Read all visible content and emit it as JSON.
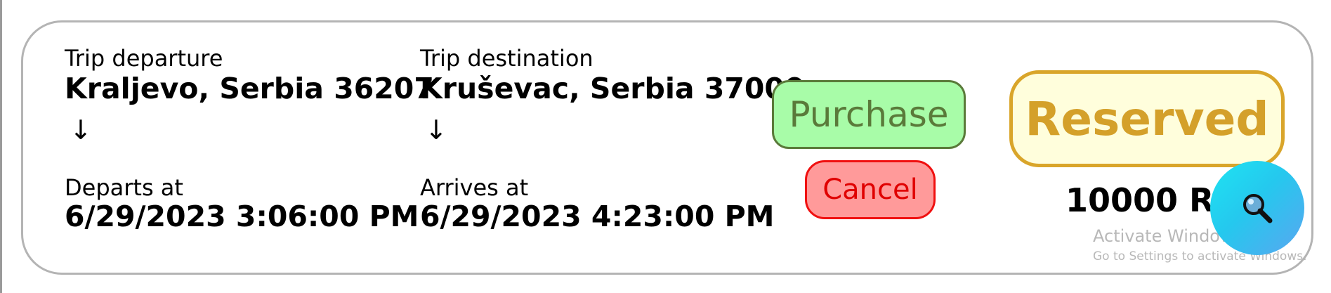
{
  "trip": {
    "departure_label": "Trip departure",
    "departure_value": "Kraljevo, Serbia 36207",
    "departure_arrow": "↓",
    "departs_label": "Departs at",
    "departs_value": "6/29/2023 3:06:00 PM",
    "destination_label": "Trip destination",
    "destination_value": "Kruševac, Serbia 37000",
    "destination_arrow": "↓",
    "arrives_label": "Arrives at",
    "arrives_value": "6/29/2023 4:23:00 PM"
  },
  "actions": {
    "purchase_label": "Purchase",
    "cancel_label": "Cancel"
  },
  "status": {
    "label": "Reserved",
    "price": "10000 RSD"
  },
  "overlay": {
    "watermark_title": "Activate Windows",
    "watermark_subtitle": "Go to Settings to activate Windows.",
    "fab_icon": "search-icon"
  },
  "colors": {
    "purchase_bg": "#a8fca8",
    "purchase_border": "#5a7a3a",
    "cancel_bg": "#ff9a9a",
    "cancel_border": "#f01010",
    "reserved_bg": "#fffedc",
    "reserved_accent": "#d9a52a",
    "fab": "#25c8ee"
  }
}
